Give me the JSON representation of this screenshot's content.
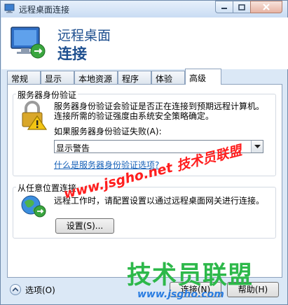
{
  "window": {
    "title": "远程桌面连接",
    "header_line1": "远程桌面",
    "header_line2": "连接"
  },
  "tabs": [
    {
      "label": "常规"
    },
    {
      "label": "显示"
    },
    {
      "label": "本地资源"
    },
    {
      "label": "程序"
    },
    {
      "label": "体验"
    },
    {
      "label": "高级"
    }
  ],
  "active_tab": "高级",
  "server_auth": {
    "group_title": "服务器身份验证",
    "desc_line1": "服务器身份验证会验证是否正在连接到预期远程计算机。",
    "desc_line2": "连接所需的验证强度由系统安全策略确定。",
    "dropdown_label": "如果服务器身份验证失败(A):",
    "dropdown_value": "显示警告",
    "help_link": "什么是服务器身份验证选项?"
  },
  "connect_anywhere": {
    "group_title": "从任意位置连接",
    "desc": "远程工作时，请配置设置以通过远程桌面网关进行连接。",
    "settings_button": "设置(S)..."
  },
  "footer": {
    "options_label": "选项(O)",
    "connect_button": "连接(N)",
    "help_button": "帮助(H)"
  },
  "watermarks": {
    "main": "www.jsgho.net 技术员联盟",
    "brand": "技术员联盟",
    "url": "www.jsgho.com"
  },
  "colors": {
    "header_text": "#1e4f8f",
    "link": "#1560b8",
    "watermark_red": "#ff1e1e",
    "watermark_green": "#2db84a",
    "watermark_blue": "#2a7de1"
  }
}
